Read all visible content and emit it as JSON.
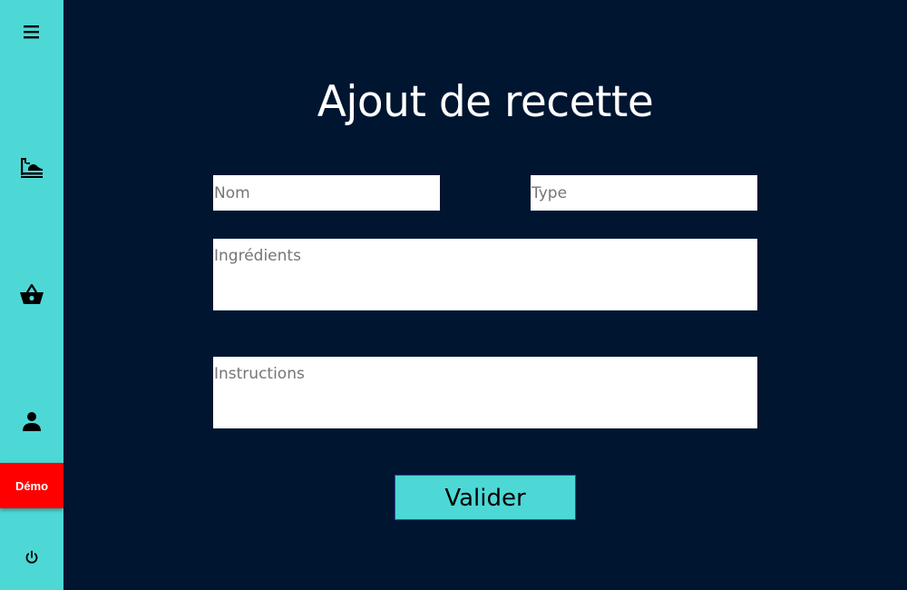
{
  "sidebar": {
    "icons": {
      "menu": "menu-icon",
      "kitchen": "stove-icon",
      "basket": "basket-icon",
      "user": "user-icon",
      "power": "power-icon"
    },
    "demo_label": "Démo"
  },
  "main": {
    "title": "Ajout de recette",
    "form": {
      "name_placeholder": "Nom",
      "type_placeholder": "Type",
      "ingredients_placeholder": "Ingrédients",
      "instructions_placeholder": "Instructions",
      "submit_label": "Valider"
    }
  },
  "colors": {
    "sidebar_bg": "#4dd8d6",
    "page_bg": "#001530",
    "demo_badge": "#ff0000",
    "button_bg": "#4dd8d6",
    "button_border": "#3b3fb0"
  }
}
